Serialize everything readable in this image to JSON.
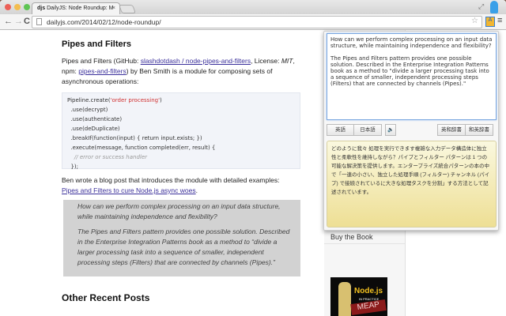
{
  "browser": {
    "tab_title": "DailyJS: Node Roundup: M",
    "tab_favicon": "djs",
    "url": "dailyjs.com/2014/02/12/node-roundup/"
  },
  "article": {
    "heading": "Pipes and Filters",
    "intro_1": "Pipes and Filters (GitHub: ",
    "github_link": "slashdotdash / node-pipes-and-filters",
    "intro_2": ", License: ",
    "license": "MIT",
    "intro_3": ", npm: ",
    "npm_link": "pipes-and-filters",
    "intro_4": ") by Ben Smith is a module for composing sets of asynchronous operations:",
    "code": {
      "line1_a": "Pipeline.create(",
      "line1_str": "'order processing'",
      "line1_b": ")",
      "lines": [
        "  .use(decrypt)",
        "  .use(authenticate)",
        "  .use(deDuplicate)",
        "  .breakIf(function(input) { return input.exists; })",
        "  .execute(message, function completed(err, result) {"
      ],
      "comment": "    // error or success handler",
      "last": "  });"
    },
    "followup": "Ben wrote a blog post that introduces the module with detailed examples:",
    "followup_link": "Pipes and Filters to cure Node.js async woes",
    "quote_1": "How can we perform complex processing on an input data structure, while maintaining independence and flexibility?",
    "quote_2": "The Pipes and Filters pattern provides one possible solution. Described in the Enterprise Integration Patterns book as a method to “divide a larger processing task into a sequence of smaller, independent processing steps (Filters) that are connected by channels (Pipes).”",
    "other_heading": "Other Recent Posts"
  },
  "sidebar": {
    "buy_heading": "Buy the Book",
    "book_title": "Node.js",
    "book_subtitle": "IN PRACTICE",
    "book_badge": "MEAP"
  },
  "translator": {
    "source_text": "How can we perform complex processing on an input data structure, while maintaining independence and flexibility?\n\nThe Pipes and Filters pattern provides one possible solution. Described in the Enterprise Integration Patterns book as a method to \"divide a larger processing task into a sequence of smaller, independent processing steps (Filters) that are connected by channels (Pipes).\"",
    "btn_english": "英語",
    "btn_japanese": "日本語",
    "btn_speak": "🔈",
    "btn_ej_dict": "英和辞書",
    "btn_je_dict": "和英辞書",
    "translation": "どのように我々 処理を実行できます複雑な入力データ構造体に独立性と柔軟性を維持しながら？パイプとフィルター パターンは 1 つの可能な解決策を提供します。エンタープライズ統合パターンの本の中で「一連の小さい、独立した処理手順 (フィルター) チャンネル (パイプ) で接続されているに大きな処理タスクを分割」する方法として記述されています。"
  }
}
